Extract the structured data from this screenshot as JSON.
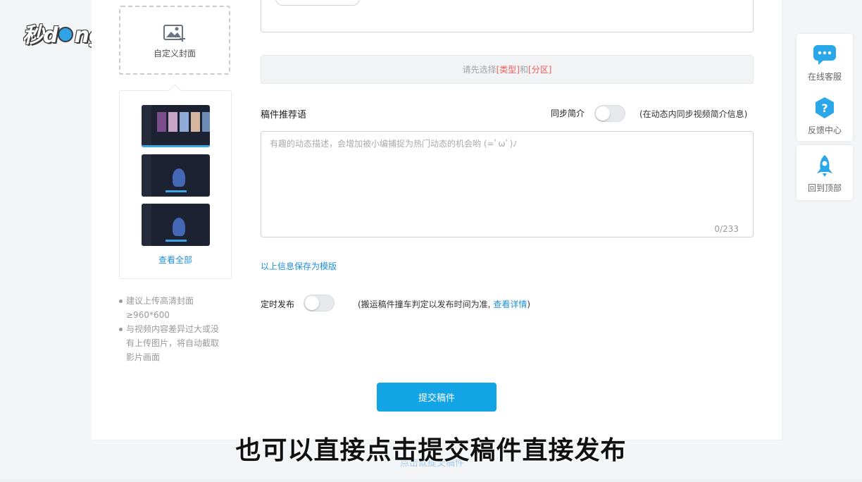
{
  "watermark": {
    "text_left": "秒d",
    "text_right": "ng视频"
  },
  "cover": {
    "custom_label": "自定义封面",
    "view_all": "查看全部",
    "tips": [
      {
        "line1": "建议上传高清封面",
        "line2": "≥960*600"
      },
      {
        "line1": "与视频内容差异过大或没",
        "line2": "有上传图片，将自动截取",
        "line3": "影片画面"
      }
    ]
  },
  "form": {
    "type_notice": {
      "prefix": "请先选择 ",
      "type": "[类型]",
      "middle": "和 ",
      "section": "[分区]"
    },
    "recommend": {
      "label": "稿件推荐语",
      "sync_label": "同步简介",
      "sync_note": "(在动态内同步视频简介信息)",
      "placeholder": "有趣的动态描述，会增加被小编捕捉为热门动态的机会哟 (=ﾟωﾟ)ﾉ",
      "counter": "0/233"
    },
    "save_template": "以上信息保存为模版",
    "schedule": {
      "label": "定时发布",
      "note_prefix": "(搬运稿件撞车判定以发布时间为准, ",
      "note_link": "查看详情",
      "note_suffix": ")"
    },
    "submit_label": "提交稿件"
  },
  "side_tools": {
    "online_service": "在线客服",
    "feedback": "反馈中心",
    "back_to_top": "回到顶部"
  },
  "subtitle": "也可以直接点击提交稿件直接发布",
  "ghost_text": "点击就提交稿件",
  "colors": {
    "accent": "#12a4e5",
    "link": "#1e8fd6",
    "warning": "#f45a5a"
  }
}
